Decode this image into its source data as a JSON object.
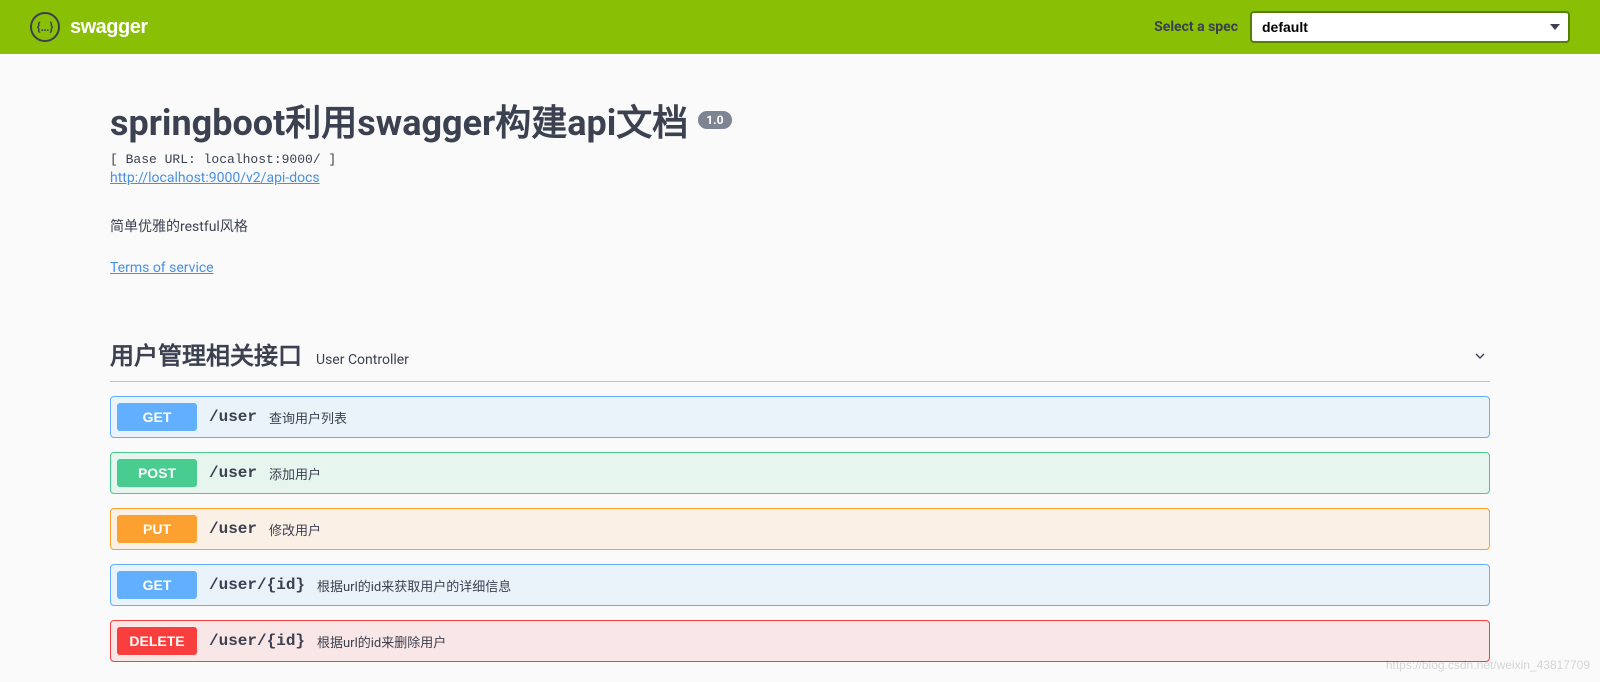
{
  "topbar": {
    "brand": "swagger",
    "spec_label": "Select a spec",
    "spec_selected": "default"
  },
  "info": {
    "title": "springboot利用swagger构建api文档",
    "version": "1.0",
    "base_url": "[ Base URL: localhost:9000/ ]",
    "api_docs_url": "http://localhost:9000/v2/api-docs",
    "description": "简单优雅的restful风格",
    "tos_label": "Terms of service"
  },
  "tag": {
    "name": "用户管理相关接口",
    "description": "User Controller"
  },
  "operations": [
    {
      "method": "GET",
      "path": "/user",
      "summary": "查询用户列表"
    },
    {
      "method": "POST",
      "path": "/user",
      "summary": "添加用户"
    },
    {
      "method": "PUT",
      "path": "/user",
      "summary": "修改用户"
    },
    {
      "method": "GET",
      "path": "/user/{id}",
      "summary": "根据url的id来获取用户的详细信息"
    },
    {
      "method": "DELETE",
      "path": "/user/{id}",
      "summary": "根据url的id来删除用户"
    }
  ],
  "watermark": "https://blog.csdn.net/weixin_43817709"
}
